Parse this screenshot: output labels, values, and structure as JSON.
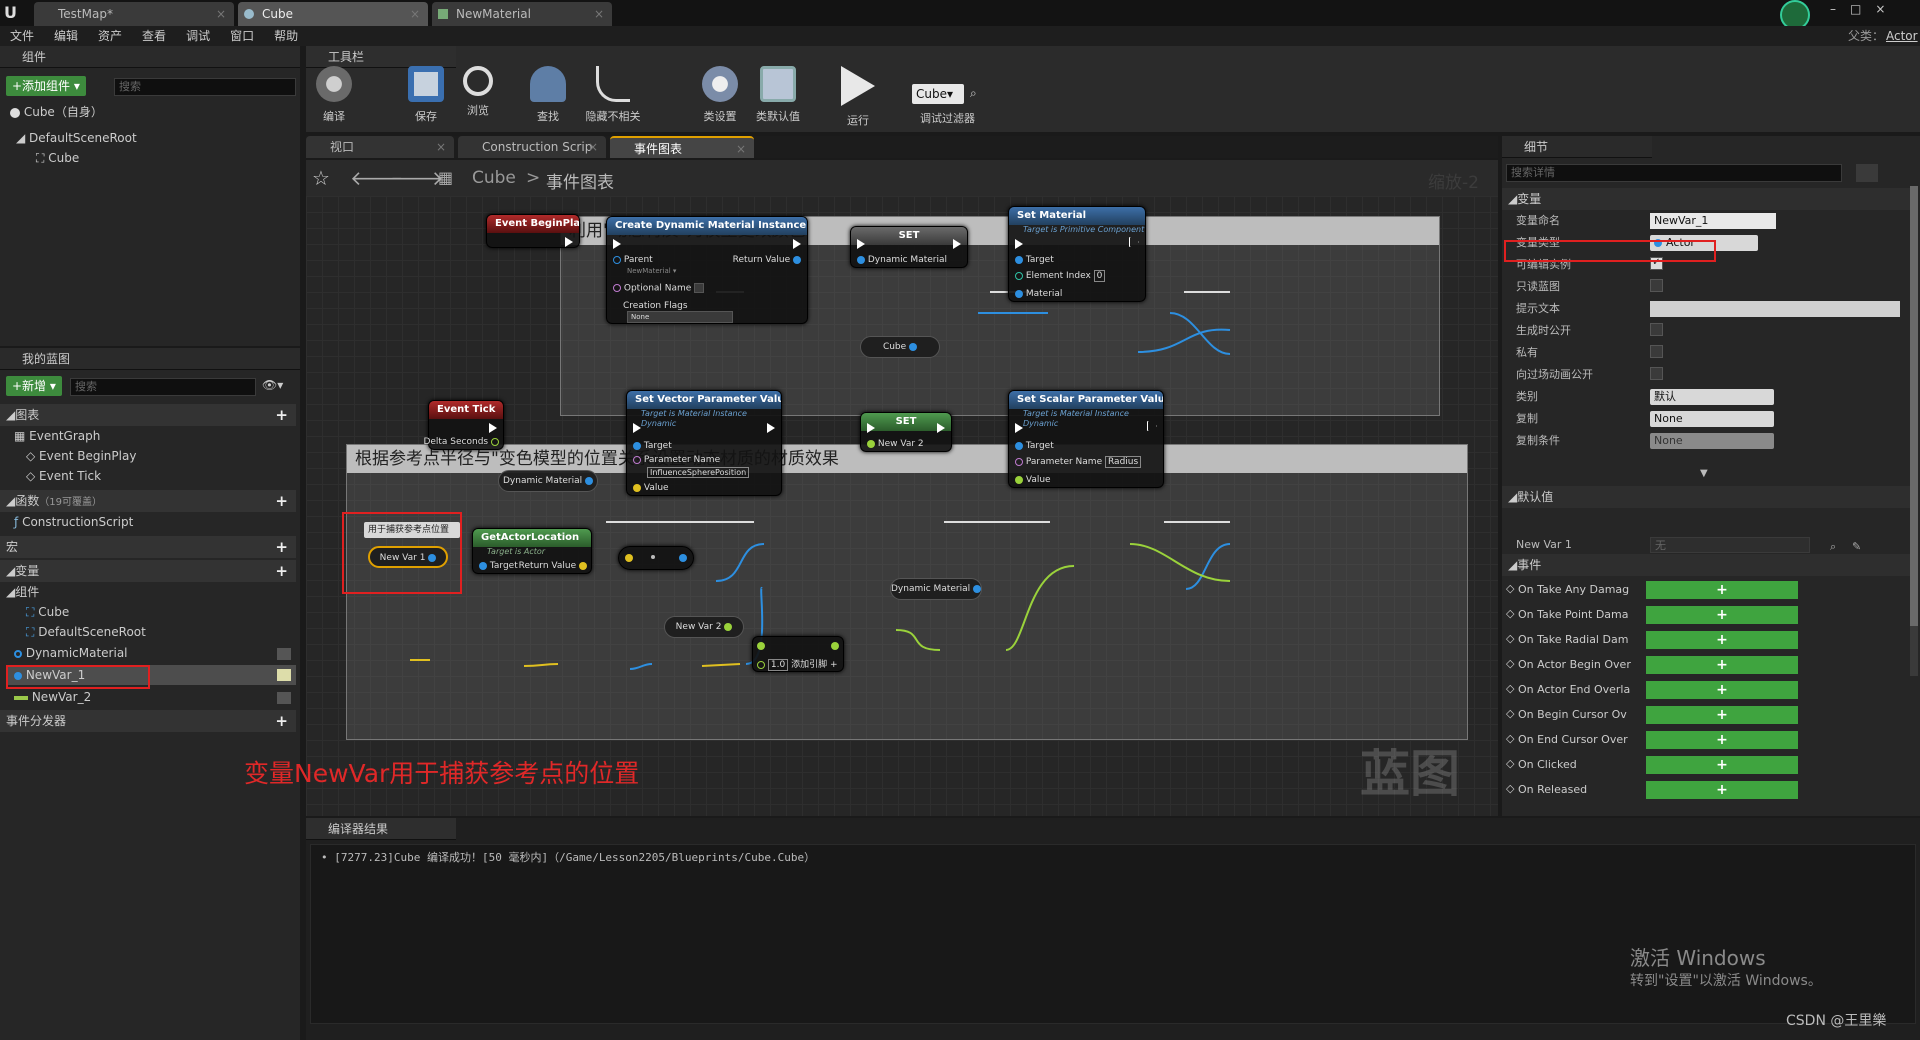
{
  "tabs": [
    {
      "label": "TestMap*"
    },
    {
      "label": "Cube"
    },
    {
      "label": "NewMaterial"
    }
  ],
  "window": {
    "parent_label": "父类：",
    "parent_value": "Actor"
  },
  "menu": [
    "文件",
    "编辑",
    "资产",
    "查看",
    "调试",
    "窗口",
    "帮助"
  ],
  "components": {
    "title": "组件",
    "add_button": "+添加组件 ▾",
    "search_placeholder": "搜索",
    "self_item": "Cube（自身）",
    "tree": [
      {
        "label": "DefaultSceneRoot"
      },
      {
        "label": "Cube"
      }
    ]
  },
  "toolbar": {
    "title": "工具栏",
    "buttons": [
      {
        "label": "编译"
      },
      {
        "label": "保存"
      },
      {
        "label": "浏览"
      },
      {
        "label": "查找"
      },
      {
        "label": "隐藏不相关"
      },
      {
        "label": "类设置"
      },
      {
        "label": "类默认值"
      },
      {
        "label": "运行"
      }
    ],
    "debug_select": "Cube▾",
    "debug_label": "调试过滤器"
  },
  "editor_tabs": [
    {
      "label": "视口"
    },
    {
      "label": "Construction Scrip"
    },
    {
      "label": "事件图表"
    }
  ],
  "breadcrumb": {
    "root": "Cube",
    "sep": ">",
    "current": "事件图表",
    "zoom": "缩放-2"
  },
  "my_blueprint": {
    "title": "我的蓝图",
    "new_button": "+新增 ▾",
    "search_placeholder": "搜索",
    "sections": {
      "graphs": "图表",
      "functions": "函数",
      "functions_count": "（19可覆盖）",
      "macros": "宏",
      "variables": "变量",
      "components": "组件",
      "dispatchers": "事件分发器"
    },
    "graph_items": [
      "EventGraph",
      "Event BeginPlay",
      "Event Tick"
    ],
    "function_items": [
      "ConstructionScript"
    ],
    "component_vars": [
      "Cube",
      "DefaultSceneRoot"
    ],
    "variables": [
      "DynamicMaterial",
      "NewVar_1",
      "NewVar_2"
    ]
  },
  "annotation": "变量NewVar用于捕获参考点的位置",
  "graph": {
    "watermark": "蓝图",
    "comment1": "利用\"动态材质\"为模型更改颜色",
    "comment2": "根据参考点半径与\"变色模型的位置关系设置动态材质的材质效果",
    "n_beginplay": "Event BeginPlay",
    "n_cdmi": {
      "title": "Create Dynamic Material Instance",
      "parent": "Parent",
      "parent_val": "NewMaterial ▾",
      "return": "Return Value",
      "optional": "Optional Name",
      "flags": "Creation Flags",
      "flags_val": "None"
    },
    "n_set1": {
      "title": "SET",
      "pin": "Dynamic Material"
    },
    "n_cube": "Cube",
    "n_setmat": {
      "title": "Set Material",
      "sub": "Target is Primitive Component",
      "target": "Target",
      "index": "Element Index",
      "index_val": "0",
      "material": "Material"
    },
    "n_tick": {
      "title": "Event Tick",
      "delta": "Delta Seconds"
    },
    "n_dynmat": "Dynamic Material",
    "n_setvec": {
      "title": "Set Vector Parameter Value",
      "sub": "Target is Material Instance Dynamic",
      "target": "Target",
      "pname": "Parameter Name",
      "pname_val": "InfluenceSpherePosition",
      "value": "Value"
    },
    "n_set2": {
      "title": "SET",
      "pin": "New Var 2"
    },
    "n_setscalar": {
      "title": "Set Scalar Parameter Value",
      "sub": "Target is Material Instance Dynamic",
      "target": "Target",
      "pname": "Parameter Name",
      "pname_val": "Radius",
      "value": "Value"
    },
    "n_dynmat2": "Dynamic Material",
    "n_newvar2": "New Var 2",
    "n_add": {
      "val": "1.0",
      "label": "添加引脚 +"
    },
    "n_note": "用于捕获参考点位置",
    "n_newvar1": "New Var 1",
    "n_getloc": {
      "title": "GetActorLocation",
      "sub": "Target is Actor",
      "target": "Target",
      "ret": "Return Value"
    }
  },
  "details": {
    "title": "细节",
    "search_placeholder": "搜索详情",
    "sec_var": "变量",
    "rows": [
      {
        "label": "变量命名",
        "value": "NewVar_1"
      },
      {
        "label": "变量类型",
        "value": "Actor"
      },
      {
        "label": "可编辑实例",
        "value": "✓"
      },
      {
        "label": "只读蓝图",
        "value": ""
      },
      {
        "label": "提示文本",
        "value": ""
      },
      {
        "label": "生成时公开",
        "value": ""
      },
      {
        "label": "私有",
        "value": ""
      },
      {
        "label": "向过场动画公开",
        "value": ""
      },
      {
        "label": "类别",
        "value": "默认"
      },
      {
        "label": "复制",
        "value": "None"
      },
      {
        "label": "复制条件",
        "value": "None"
      }
    ],
    "sec_default": "默认值",
    "default_label": "New Var 1",
    "default_value": "无",
    "sec_events": "事件",
    "events": [
      "On Take Any Damag",
      "On Take Point Dama",
      "On Take Radial Dam",
      "On Actor Begin Over",
      "On Actor End Overla",
      "On Begin Cursor Ov",
      "On End Cursor Over",
      "On Clicked",
      "On Released"
    ],
    "event_btn": "+"
  },
  "compiler": {
    "title": "编译器结果",
    "message": "[7277.23]Cube 编译成功！[50 毫秒内]（/Game/Lesson2205/Blueprints/Cube.Cube）"
  },
  "activate": {
    "line1": "激活 Windows",
    "line2": "转到\"设置\"以激活 Windows。"
  },
  "csdn": "CSDN @王里樂"
}
